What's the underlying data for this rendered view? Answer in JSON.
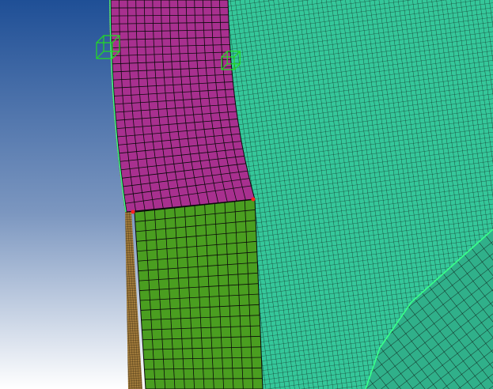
{
  "viewport": {
    "description_hidden": "",
    "background": {
      "top_color": "#1f4f96",
      "bottom_color": "#ffffff"
    }
  },
  "colors": {
    "outer_body": "#35c79a",
    "outer_body_dark": "#2aa883",
    "fillet_part": "#a8308f",
    "fillet_part_light": "#c245a8",
    "lower_part": "#4a9e20",
    "lower_part_light": "#5bb02c",
    "back_face": "#a07a3a",
    "corner_block": "#30b08a",
    "mesh_line": "#0a0a0a",
    "edge_highlight": "#39ff8a",
    "marker_green": "#22dd22",
    "marker_red": "#ff2020"
  },
  "markers": {
    "triad_left_icon": "axis-triad-icon",
    "triad_right_icon": "axis-triad-icon",
    "node_marker_icon": "node-marker-icon"
  }
}
